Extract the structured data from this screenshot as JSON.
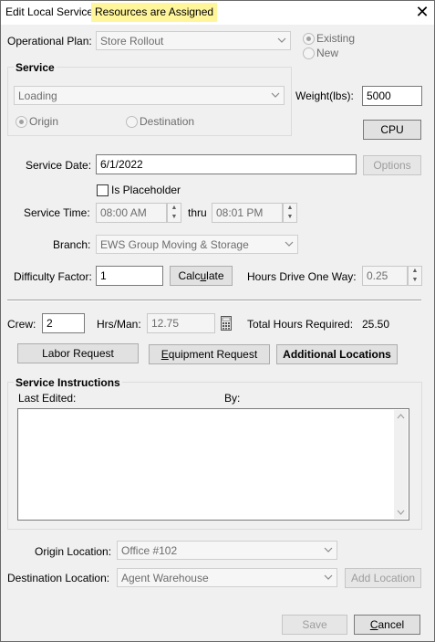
{
  "window": {
    "title": "Edit Local Service -",
    "status_highlight": "Resources are Assigned"
  },
  "operational_plan": {
    "label": "Operational Plan:",
    "value": "Store Rollout",
    "existing_label": "Existing",
    "new_label": "New"
  },
  "service": {
    "group_title": "Service",
    "type_value": "Loading",
    "origin_label": "Origin",
    "destination_label": "Destination",
    "weight_label": "Weight(lbs):",
    "weight_value": "5000",
    "cpu_label": "CPU"
  },
  "service_date": {
    "label": "Service Date:",
    "value": "6/1/2022",
    "options_label": "Options",
    "placeholder_label": "Is Placeholder"
  },
  "service_time": {
    "label": "Service Time:",
    "from": "08:00 AM",
    "thru_label": "thru",
    "to": "08:01 PM"
  },
  "branch": {
    "label": "Branch:",
    "value": "EWS Group Moving & Storage"
  },
  "difficulty": {
    "label": "Difficulty Factor:",
    "value": "1",
    "calculate_pre": "Calc",
    "calculate_u": "u",
    "calculate_post": "late",
    "hours_drive_label": "Hours Drive One Way:",
    "hours_drive_value": "0.25"
  },
  "crew": {
    "crew_label": "Crew:",
    "crew_value": "2",
    "hrs_man_label": "Hrs/Man:",
    "hrs_man_value": "12.75",
    "total_label": "Total Hours Required:",
    "total_value": "25.50"
  },
  "requests": {
    "labor_label": "Labor Request",
    "equipment_u": "E",
    "equipment_rest": "quipment Request",
    "additional_label": "Additional Locations"
  },
  "instructions": {
    "group_title": "Service Instructions",
    "last_edited_label": "Last Edited:",
    "by_label": "By:",
    "text": ""
  },
  "locations": {
    "origin_label": "Origin Location:",
    "origin_value": "Office #102",
    "destination_label": "Destination Location:",
    "destination_value": "Agent Warehouse",
    "add_location_label": "Add Location"
  },
  "footer": {
    "save_label": "Save",
    "cancel_u": "C",
    "cancel_rest": "ancel"
  },
  "colors": {
    "highlight": "#fff59a",
    "window_bg": "#f0f0f0"
  }
}
